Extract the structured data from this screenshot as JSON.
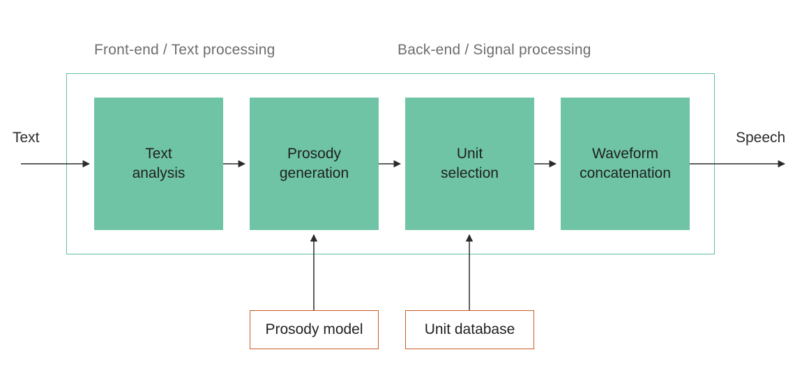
{
  "section_labels": {
    "front": "Front-end / Text processing",
    "back": "Back-end / Signal processing"
  },
  "io": {
    "input": "Text",
    "output": "Speech"
  },
  "blocks": {
    "text_analysis_l1": "Text",
    "text_analysis_l2": "analysis",
    "prosody_gen_l1": "Prosody",
    "prosody_gen_l2": "generation",
    "unit_sel_l1": "Unit",
    "unit_sel_l2": "selection",
    "waveform_l1": "Waveform",
    "waveform_l2": "concatenation"
  },
  "data_sources": {
    "prosody_model": "Prosody model",
    "unit_database": "Unit database"
  },
  "colors": {
    "process_fill": "#6fc4a6",
    "container_border": "#63bfa0",
    "data_border": "#c95b23",
    "label_grey": "#6d6d6d",
    "arrow": "#2b2b2b"
  }
}
